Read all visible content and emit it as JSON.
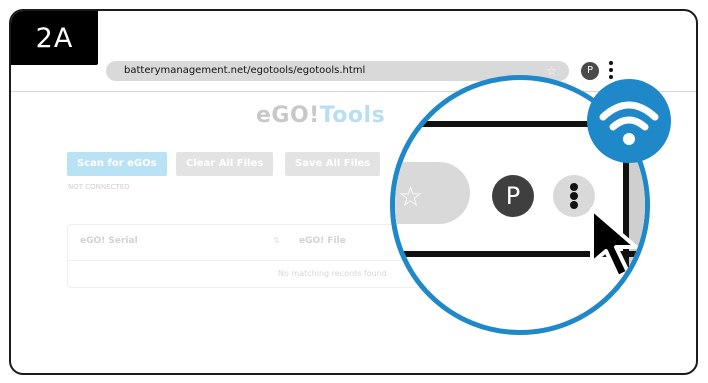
{
  "step_label": "2A",
  "browser": {
    "url": "batterymanagement.net/egotools/egotools.html",
    "profile_initial": "P"
  },
  "app": {
    "title_part1": "eGO!",
    "title_part2": "Tools",
    "buttons": {
      "scan": "Scan for eGOs",
      "clear": "Clear All Files",
      "save": "Save All Files"
    },
    "status": "NOT CONNECTED",
    "table": {
      "columns": [
        "eGO! Serial",
        "eGO! File"
      ],
      "empty_message": "No matching records found"
    }
  },
  "magnifier": {
    "profile_initial": "P"
  },
  "icons": {
    "address_bookmark": "star-icon",
    "menu": "kebab-menu-icon",
    "pointer": "mouse-cursor-icon",
    "badge": "wifi-icon"
  },
  "colors": {
    "accent_blue": "#1f88c9",
    "step_label_bg": "#000000",
    "scan_button": "#b9e2f5"
  }
}
